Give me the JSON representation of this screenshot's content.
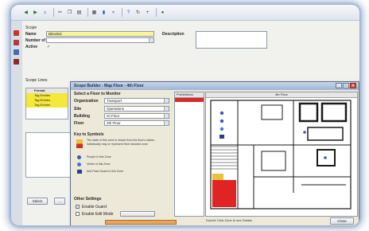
{
  "toolbar": {
    "icons": [
      "back-icon",
      "forward-icon",
      "home-icon",
      "divider",
      "cut-icon",
      "copy-icon",
      "paste-icon",
      "divider",
      "print-icon",
      "chart-icon",
      "filter-icon",
      "divider",
      "help-icon",
      "refresh-icon",
      "add-icon",
      "divider",
      "go-icon"
    ]
  },
  "form": {
    "section_label": "Scope",
    "name_label": "Name",
    "name_value": "Blended",
    "number_label": "Number of",
    "active_label": "Active",
    "active_check": "✓",
    "description_label": "Description",
    "scope_label": "Scope Lines",
    "scope_header": "Format",
    "scope_rows": [
      "Tag Entries",
      "Tag Entries",
      "Tag Entries"
    ]
  },
  "dialog": {
    "title": "Scope Builder - Map Floor - 4th Floor",
    "select_title": "Select a Floor to Monitor",
    "org_label": "Organization",
    "org_value": "Transport",
    "site_label": "Site",
    "site_value": "Operations",
    "building_label": "Building",
    "building_value": "GI Floor",
    "floor_label": "Floor",
    "floor_value": "4th Floor",
    "key_title": "Key to Symbols",
    "key_items": [
      "The state of this zone is shown from the floor's status; individually may or represent their included zone",
      "People in this Zone",
      "Visitor in this Zone",
      "Anti-Pass Guard in this Zone"
    ],
    "other_title": "Other Settings",
    "opt1": "Enable Guard",
    "opt2": "Enable Edit Mode",
    "zones_header": "Prohibitions",
    "map_header": "4th Floor",
    "footer": "Double Click Zone to see Details",
    "close_button": "Close"
  },
  "left_buttons": {
    "btn_a": "Select",
    "btn_b": "..."
  }
}
